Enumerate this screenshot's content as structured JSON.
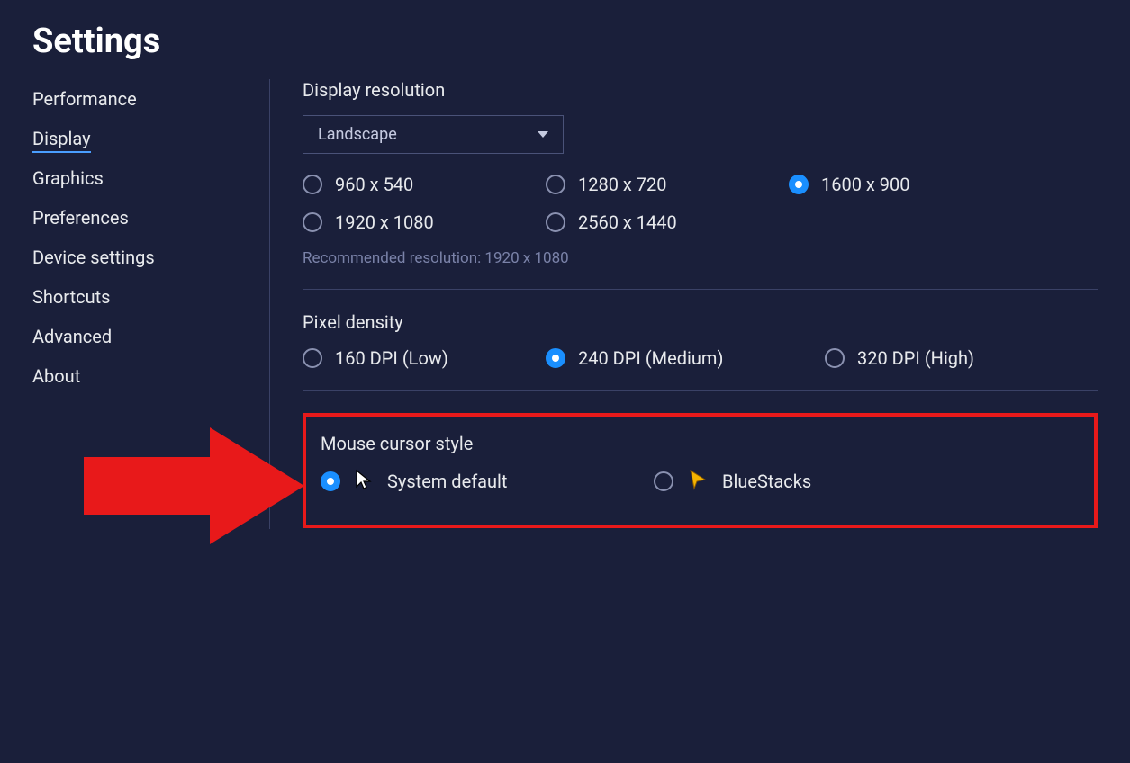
{
  "title": "Settings",
  "sidebar": {
    "items": [
      {
        "label": "Performance"
      },
      {
        "label": "Display",
        "active": true
      },
      {
        "label": "Graphics"
      },
      {
        "label": "Preferences"
      },
      {
        "label": "Device settings"
      },
      {
        "label": "Shortcuts"
      },
      {
        "label": "Advanced"
      },
      {
        "label": "About"
      }
    ]
  },
  "display": {
    "heading": "Display resolution",
    "orientation": {
      "selected": "Landscape"
    },
    "resolutions": [
      {
        "label": "960 x 540",
        "selected": false
      },
      {
        "label": "1280 x 720",
        "selected": false
      },
      {
        "label": "1600 x 900",
        "selected": true
      },
      {
        "label": "1920 x 1080",
        "selected": false
      },
      {
        "label": "2560 x 1440",
        "selected": false
      }
    ],
    "recommended": "Recommended resolution: 1920 x 1080"
  },
  "pixel_density": {
    "heading": "Pixel density",
    "options": [
      {
        "label": "160 DPI (Low)",
        "selected": false
      },
      {
        "label": "240 DPI (Medium)",
        "selected": true
      },
      {
        "label": "320 DPI (High)",
        "selected": false
      }
    ]
  },
  "cursor": {
    "heading": "Mouse cursor style",
    "options": [
      {
        "label": "System default",
        "selected": true,
        "icon": "system"
      },
      {
        "label": "BlueStacks",
        "selected": false,
        "icon": "bluestacks"
      }
    ]
  },
  "colors": {
    "accent": "#1a8fff",
    "highlight_border": "#e8191a"
  }
}
